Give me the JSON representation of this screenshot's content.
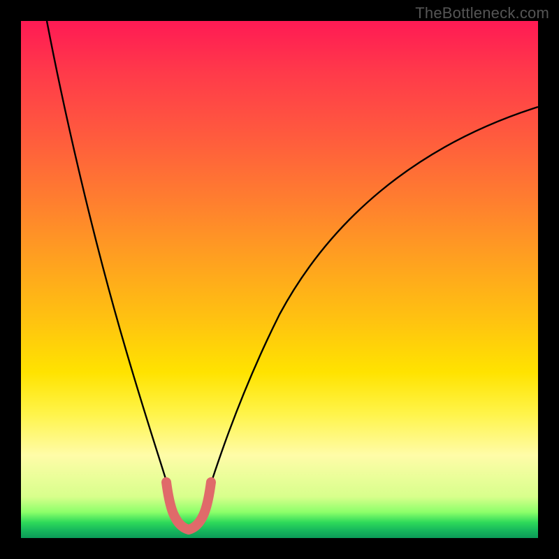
{
  "watermark": "TheBottleneck.com",
  "colors": {
    "page_bg": "#000000",
    "curve_stroke": "#000000",
    "u_marker_stroke": "#e06a6a",
    "gradient_stops": [
      "#ff1a54",
      "#ff3a4a",
      "#ff5a3e",
      "#ff7c30",
      "#ffa020",
      "#ffc310",
      "#ffe300",
      "#fff44a",
      "#fffca8",
      "#d8ff8c",
      "#8cff6a",
      "#2dd95a",
      "#17b85c",
      "#0c9a58"
    ]
  },
  "chart_data": {
    "type": "line",
    "title": "",
    "xlabel": "",
    "ylabel": "",
    "xlim": [
      0,
      100
    ],
    "ylim": [
      0,
      100
    ],
    "grid": false,
    "series": [
      {
        "name": "left-branch",
        "x": [
          5,
          8,
          12,
          16,
          20,
          24,
          28,
          30
        ],
        "values": [
          100,
          85,
          68,
          50,
          34,
          20,
          8,
          2
        ]
      },
      {
        "name": "right-branch",
        "x": [
          34,
          38,
          44,
          52,
          62,
          74,
          88,
          100
        ],
        "values": [
          2,
          10,
          24,
          40,
          55,
          68,
          78,
          83
        ]
      },
      {
        "name": "trough-u-marker",
        "x": [
          28,
          29,
          30,
          31,
          32,
          33,
          34,
          35,
          36
        ],
        "values": [
          10,
          5,
          2,
          1,
          1,
          1,
          2,
          5,
          10
        ]
      }
    ],
    "annotations": [
      {
        "text": "TheBottleneck.com",
        "position": "top-right"
      }
    ]
  }
}
